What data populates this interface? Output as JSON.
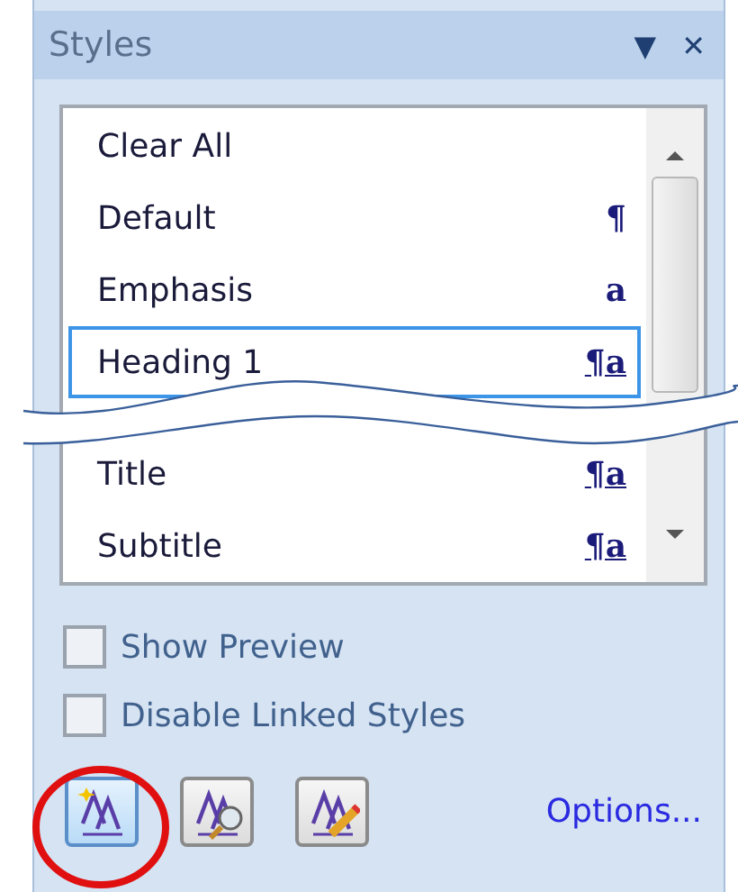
{
  "pane": {
    "title": "Styles",
    "menu_glyph": "▼",
    "close_glyph": "✕"
  },
  "styles": [
    {
      "name": "Clear All",
      "kind": "none",
      "selected": false
    },
    {
      "name": "Default",
      "kind": "paragraph",
      "mark": "¶",
      "selected": false
    },
    {
      "name": "Emphasis",
      "kind": "character",
      "mark": "a",
      "selected": false
    },
    {
      "name": "Heading 1",
      "kind": "linked",
      "mark": "¶a",
      "selected": true
    },
    {
      "name": "Title",
      "kind": "linked",
      "mark": "¶a",
      "selected": false
    },
    {
      "name": "Subtitle",
      "kind": "linked",
      "mark": "¶a",
      "selected": false
    }
  ],
  "options": [
    {
      "label": "Show Preview",
      "checked": false
    },
    {
      "label": "Disable Linked Styles",
      "checked": false
    }
  ],
  "tool_buttons": [
    {
      "kind": "new-style",
      "selected": true,
      "circled": true
    },
    {
      "kind": "style-inspector",
      "selected": false,
      "circled": false
    },
    {
      "kind": "manage-styles",
      "selected": false,
      "circled": false
    }
  ],
  "options_link": "Options..."
}
